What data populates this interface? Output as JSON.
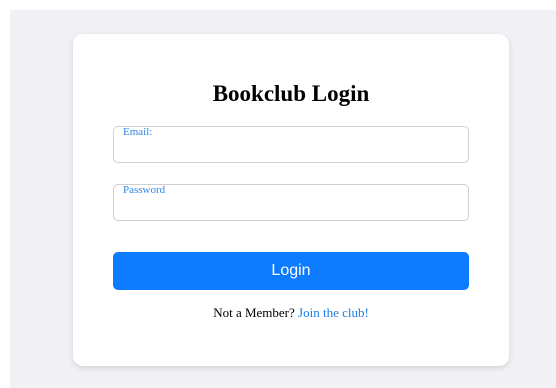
{
  "login_form": {
    "title": "Bookclub Login",
    "email_label": "Email:",
    "email_value": "",
    "password_label": "Password",
    "password_value": "",
    "login_button_label": "Login",
    "footer_text": "Not a Member?",
    "join_link_text": "Join the club!"
  },
  "colors": {
    "page_background": "#f1f1f5",
    "card_background": "#ffffff",
    "accent": "#0d7bff",
    "label_text": "#2f86e6",
    "link_text": "#1a7ce6"
  }
}
